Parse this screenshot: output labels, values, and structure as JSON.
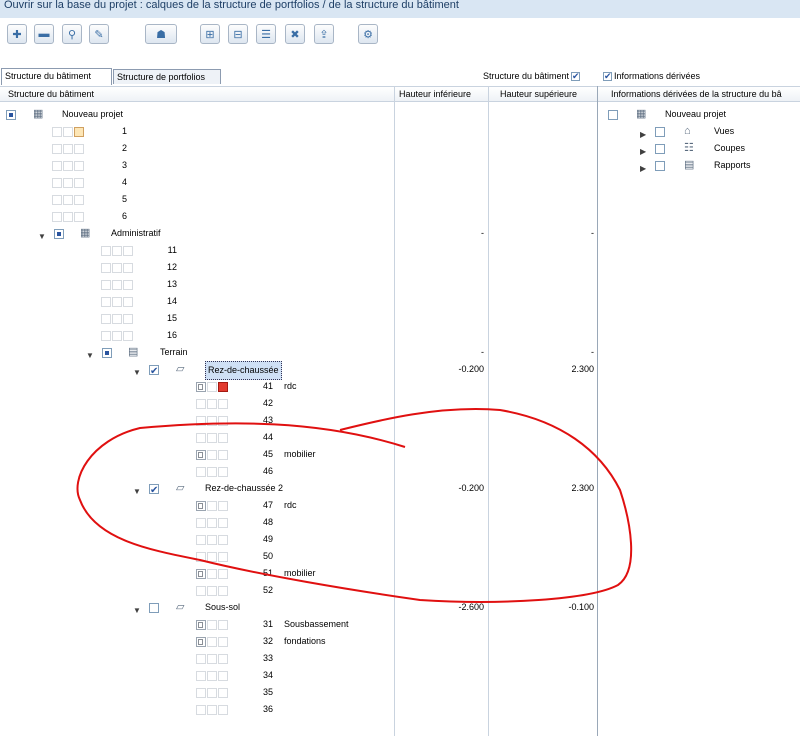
{
  "title": "Ouvrir sur la base du projet : calques de la structure de portfolios / de la structure du bâtiment",
  "toolbar": {
    "buttons": [
      "plus-icon",
      "minus-icon",
      "search-icon",
      "link-icon",
      "person-icon",
      "tree-up-icon",
      "tree-down-icon",
      "level-icon",
      "delete-level-icon",
      "export-icon",
      "settings-icon"
    ]
  },
  "tabs": {
    "active": "Structure du bâtiment",
    "other": "Structure de portfolios"
  },
  "options": {
    "structure_label": "Structure du bâtiment",
    "derived_label": "Informations dérivées"
  },
  "columns": {
    "structure": "Structure du bâtiment",
    "lower": "Hauteur inférieure",
    "upper": "Hauteur supérieure",
    "derived": "Informations dérivées de la structure du bâ"
  },
  "tree": {
    "project": "Nouveau projet",
    "project_items": [
      "1",
      "2",
      "3",
      "4",
      "5",
      "6"
    ],
    "building": "Administratif",
    "building_lower": "-",
    "building_upper": "-",
    "building_items": [
      "11",
      "12",
      "13",
      "14",
      "15",
      "16"
    ],
    "site": "Terrain",
    "site_lower": "-",
    "site_upper": "-",
    "floors": [
      {
        "name": "Rez-de-chaussée",
        "lower": "-0.200",
        "upper": "2.300",
        "rows": [
          {
            "num": "41",
            "label": "rdc"
          },
          {
            "num": "42",
            "label": ""
          },
          {
            "num": "43",
            "label": ""
          },
          {
            "num": "44",
            "label": ""
          },
          {
            "num": "45",
            "label": "mobilier"
          },
          {
            "num": "46",
            "label": ""
          }
        ]
      },
      {
        "name": "Rez-de-chaussée 2",
        "lower": "-0.200",
        "upper": "2.300",
        "rows": [
          {
            "num": "47",
            "label": "rdc"
          },
          {
            "num": "48",
            "label": ""
          },
          {
            "num": "49",
            "label": ""
          },
          {
            "num": "50",
            "label": ""
          },
          {
            "num": "51",
            "label": "mobilier"
          },
          {
            "num": "52",
            "label": ""
          }
        ]
      },
      {
        "name": "Sous-sol",
        "lower": "-2.600",
        "upper": "-0.100",
        "rows": [
          {
            "num": "31",
            "label": "Sousbassement"
          },
          {
            "num": "32",
            "label": "fondations"
          },
          {
            "num": "33",
            "label": ""
          },
          {
            "num": "34",
            "label": ""
          },
          {
            "num": "35",
            "label": ""
          },
          {
            "num": "36",
            "label": ""
          }
        ]
      }
    ]
  },
  "derived": {
    "project": "Nouveau projet",
    "items": [
      "Vues",
      "Coupes",
      "Rapports"
    ]
  },
  "colors": {
    "annotation": "#e01010",
    "selection": "#cfe0f5"
  }
}
